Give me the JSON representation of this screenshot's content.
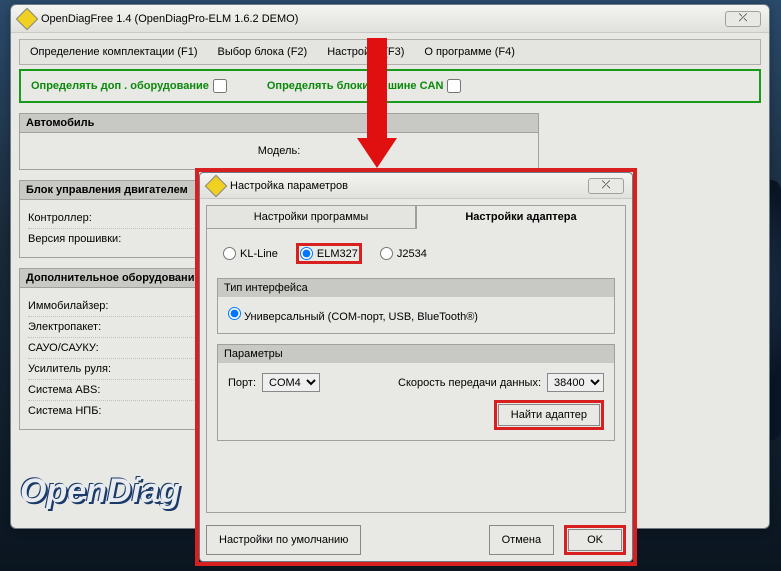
{
  "mainWindow": {
    "title": "OpenDiagFree 1.4 (OpenDiagPro-ELM 1.6.2 DEMO)",
    "closeSymbol": "⤫",
    "menu": [
      "Определение комплектации (F1)",
      "Выбор блока (F2)",
      "Настройки (F3)",
      "О программе (F4)"
    ],
    "greenOpts": {
      "opt1": "Определять доп . оборудование",
      "opt2": "Определять блоки на шине CAN"
    },
    "sections": {
      "auto": {
        "title": "Автомобиль",
        "model": "Модель:"
      },
      "ecu": {
        "title": "Блок управления двигателем",
        "rows": [
          "Контроллер:",
          "Версия прошивки:"
        ]
      },
      "addon": {
        "title": "Дополнительное оборудование",
        "rows": [
          "Иммобилайзер:",
          "Электропакет:",
          "САУО/САУКУ:",
          "Усилитель руля:",
          "Система ABS:",
          "Система НПБ:"
        ]
      }
    },
    "brand": "OpenDiag"
  },
  "dialog": {
    "title": "Настройка параметров",
    "closeSymbol": "⤫",
    "tabs": {
      "t1": "Настройки программы",
      "t2": "Настройки адаптера"
    },
    "radios": {
      "r1": "KL-Line",
      "r2": "ELM327",
      "r3": "J2534"
    },
    "iface": {
      "title": "Тип интерфейса",
      "opt": "Универсальный (COM-порт, USB, BlueTooth®)"
    },
    "params": {
      "title": "Параметры",
      "portLabel": "Порт:",
      "portValue": "COM4",
      "speedLabel": "Скорость передачи данных:",
      "speedValue": "38400",
      "findBtn": "Найти адаптер"
    },
    "buttons": {
      "defaults": "Настройки по умолчанию",
      "cancel": "Отмена",
      "ok": "OK"
    }
  }
}
